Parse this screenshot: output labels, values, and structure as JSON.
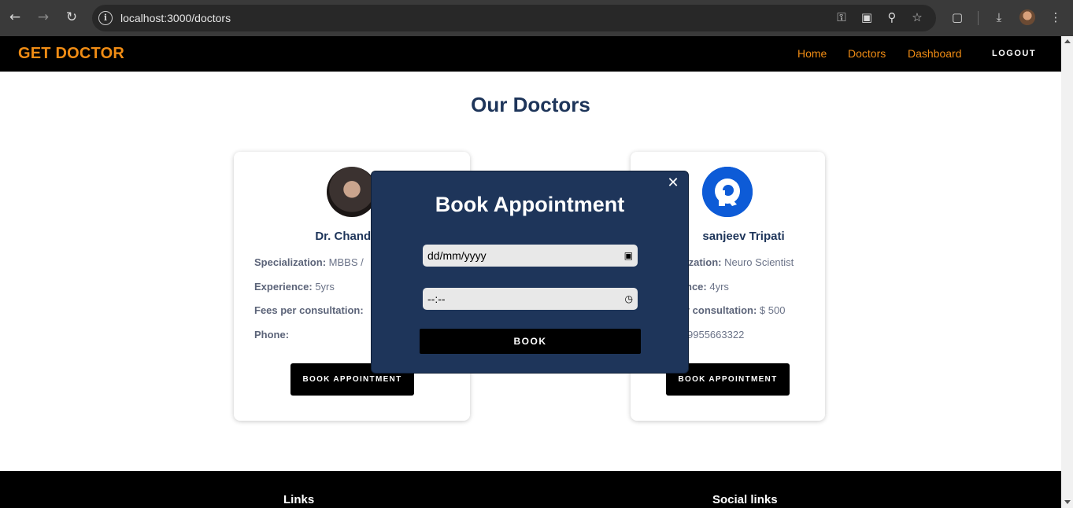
{
  "browser": {
    "url": "localhost:3000/doctors",
    "back_icon": "arrow-left",
    "forward_icon": "arrow-right",
    "reload_icon": "reload"
  },
  "header": {
    "brand": "GET DOCTOR",
    "nav": [
      "Home",
      "Doctors",
      "Dashboard"
    ],
    "logout": "LOGOUT",
    "accent_color": "#f08c14"
  },
  "main": {
    "title": "Our Doctors",
    "doctors": [
      {
        "name": "Dr. Chandrav",
        "specialization_label": "Specialization:",
        "specialization": "MBBS /",
        "experience_label": "Experience:",
        "experience": "5yrs",
        "fees_label": "Fees per consultation:",
        "fees": "",
        "phone_label": "Phone:",
        "phone": "",
        "button": "BOOK APPOINTMENT"
      },
      {
        "name": "sanjeev Tripati",
        "specialization_label": "ization:",
        "specialization": "Neuro Scientist",
        "experience_label": "nce:",
        "experience": "4yrs",
        "fees_label": "r consultation:",
        "fees": "$ 500",
        "phone_label": "",
        "phone": "9955663322",
        "button": "BOOK APPOINTMENT"
      }
    ]
  },
  "modal": {
    "title": "Book Appointment",
    "date_placeholder": "dd/mm/yyyy",
    "time_placeholder": "--:--",
    "submit": "BOOK",
    "bg_color": "#1e355a"
  },
  "footer": {
    "links_title": "Links",
    "social_title": "Social links"
  }
}
